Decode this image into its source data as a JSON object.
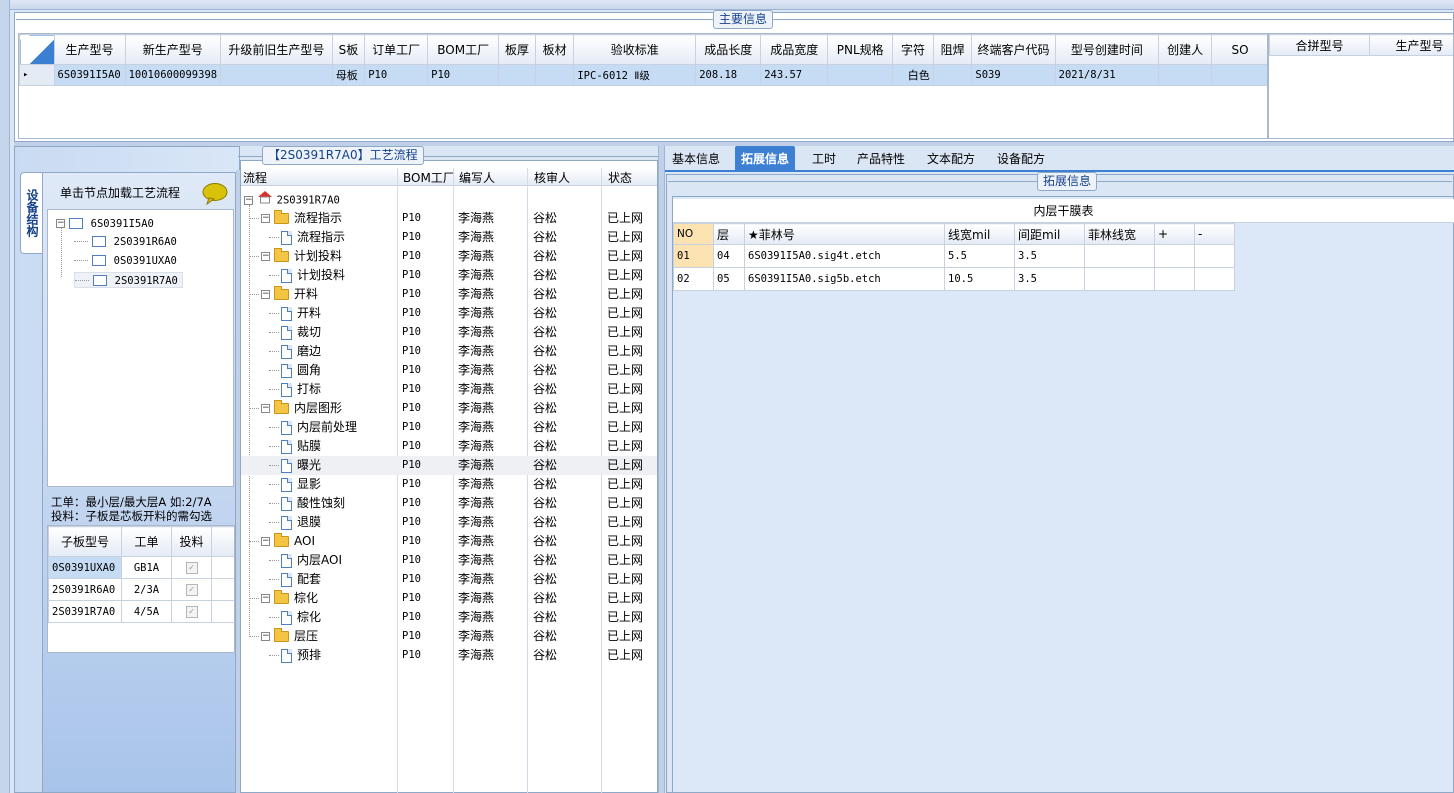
{
  "main_info": {
    "group_title": "主要信息",
    "columns": [
      "生产型号",
      "新生产型号",
      "升级前旧生产型号",
      "S板",
      "订单工厂",
      "BOM工厂",
      "板厚",
      "板材",
      "验收标准",
      "成品长度",
      "成品宽度",
      "PNL规格",
      "字符",
      "阻焊",
      "终端客户代码",
      "型号创建时间",
      "创建人",
      "SO"
    ],
    "row": [
      "6S0391I5A0",
      "10010600099398",
      "",
      "母板",
      "P10",
      "P10",
      "",
      "",
      "IPC-6012 Ⅱ级",
      "208.18",
      "243.57",
      "",
      "白色",
      "",
      "S039",
      "2021/8/31",
      "",
      ""
    ],
    "row_marker": "▸",
    "right_columns": [
      "合拼型号",
      "生产型号"
    ]
  },
  "left_panel": {
    "vertical_tab": "设备结构",
    "hint": "单击节点加载工艺流程",
    "tree": {
      "root": "6S0391I5A0",
      "children": [
        "2S0391R6A0",
        "0S0391UXA0",
        "2S0391R7A0"
      ]
    },
    "note_line1": "工单：最小层/最大层A 如:2/7A",
    "note_line2": "投料：子板是芯板开料的需勾选",
    "sub_columns": [
      "子板型号",
      "工单",
      "投料"
    ],
    "sub_rows": [
      {
        "model": "0S0391UXA0",
        "order": "GB1A",
        "check": "✓"
      },
      {
        "model": "2S0391R6A0",
        "order": "2/3A",
        "check": "✓"
      },
      {
        "model": "2S0391R7A0",
        "order": "4/5A",
        "check": "✓"
      }
    ]
  },
  "process": {
    "group_title": "【2S0391R7A0】工艺流程",
    "columns": [
      "流程",
      "BOM工厂",
      "编写人",
      "核审人",
      "状态"
    ],
    "root": "2S0391R7A0",
    "expander_minus": "−",
    "rows": [
      {
        "label": "流程指示",
        "folder": true,
        "bom": "P10",
        "writer": "李海燕",
        "reviewer": "谷松",
        "status": "已上网"
      },
      {
        "label": "流程指示",
        "folder": false,
        "bom": "P10",
        "writer": "李海燕",
        "reviewer": "谷松",
        "status": "已上网"
      },
      {
        "label": "计划投料",
        "folder": true,
        "bom": "P10",
        "writer": "李海燕",
        "reviewer": "谷松",
        "status": "已上网"
      },
      {
        "label": "计划投料",
        "folder": false,
        "bom": "P10",
        "writer": "李海燕",
        "reviewer": "谷松",
        "status": "已上网"
      },
      {
        "label": "开料",
        "folder": true,
        "bom": "P10",
        "writer": "李海燕",
        "reviewer": "谷松",
        "status": "已上网"
      },
      {
        "label": "开料",
        "folder": false,
        "bom": "P10",
        "writer": "李海燕",
        "reviewer": "谷松",
        "status": "已上网"
      },
      {
        "label": "裁切",
        "folder": false,
        "bom": "P10",
        "writer": "李海燕",
        "reviewer": "谷松",
        "status": "已上网"
      },
      {
        "label": "磨边",
        "folder": false,
        "bom": "P10",
        "writer": "李海燕",
        "reviewer": "谷松",
        "status": "已上网"
      },
      {
        "label": "圆角",
        "folder": false,
        "bom": "P10",
        "writer": "李海燕",
        "reviewer": "谷松",
        "status": "已上网"
      },
      {
        "label": "打标",
        "folder": false,
        "bom": "P10",
        "writer": "李海燕",
        "reviewer": "谷松",
        "status": "已上网"
      },
      {
        "label": "内层图形",
        "folder": true,
        "bom": "P10",
        "writer": "李海燕",
        "reviewer": "谷松",
        "status": "已上网"
      },
      {
        "label": "内层前处理",
        "folder": false,
        "bom": "P10",
        "writer": "李海燕",
        "reviewer": "谷松",
        "status": "已上网"
      },
      {
        "label": "贴膜",
        "folder": false,
        "bom": "P10",
        "writer": "李海燕",
        "reviewer": "谷松",
        "status": "已上网"
      },
      {
        "label": "曝光",
        "folder": false,
        "bom": "P10",
        "writer": "李海燕",
        "reviewer": "谷松",
        "status": "已上网",
        "selected": true
      },
      {
        "label": "显影",
        "folder": false,
        "bom": "P10",
        "writer": "李海燕",
        "reviewer": "谷松",
        "status": "已上网"
      },
      {
        "label": "酸性蚀刻",
        "folder": false,
        "bom": "P10",
        "writer": "李海燕",
        "reviewer": "谷松",
        "status": "已上网"
      },
      {
        "label": "退膜",
        "folder": false,
        "bom": "P10",
        "writer": "李海燕",
        "reviewer": "谷松",
        "status": "已上网"
      },
      {
        "label": "AOI",
        "folder": true,
        "bom": "P10",
        "writer": "李海燕",
        "reviewer": "谷松",
        "status": "已上网"
      },
      {
        "label": "内层AOI",
        "folder": false,
        "bom": "P10",
        "writer": "李海燕",
        "reviewer": "谷松",
        "status": "已上网"
      },
      {
        "label": "配套",
        "folder": false,
        "bom": "P10",
        "writer": "李海燕",
        "reviewer": "谷松",
        "status": "已上网"
      },
      {
        "label": "棕化",
        "folder": true,
        "bom": "P10",
        "writer": "李海燕",
        "reviewer": "谷松",
        "status": "已上网"
      },
      {
        "label": "棕化",
        "folder": false,
        "bom": "P10",
        "writer": "李海燕",
        "reviewer": "谷松",
        "status": "已上网"
      },
      {
        "label": "层压",
        "folder": true,
        "bom": "P10",
        "writer": "李海燕",
        "reviewer": "谷松",
        "status": "已上网"
      },
      {
        "label": "预排",
        "folder": false,
        "bom": "P10",
        "writer": "李海燕",
        "reviewer": "谷松",
        "status": "已上网"
      }
    ]
  },
  "tabs": [
    "基本信息",
    "拓展信息",
    "工时",
    "产品特性",
    "文本配方",
    "设备配方"
  ],
  "active_tab": 1,
  "ext": {
    "group_title": "拓展信息",
    "table_title": "内层干膜表",
    "columns": [
      "NO",
      "层",
      "★菲林号",
      "线宽mil",
      "间距mil",
      "菲林线宽",
      "+",
      "-"
    ],
    "rows": [
      [
        "01",
        "04",
        "6S0391I5A0.sig4t.etch",
        "5.5",
        "3.5",
        "",
        "",
        ""
      ],
      [
        "02",
        "05",
        "6S0391I5A0.sig5b.etch",
        "10.5",
        "3.5",
        "",
        "",
        ""
      ]
    ]
  },
  "colors": {
    "selection": "#c6dcf5",
    "active_tab": "#3c7fd3",
    "accent_orange": "#fde3b2"
  }
}
